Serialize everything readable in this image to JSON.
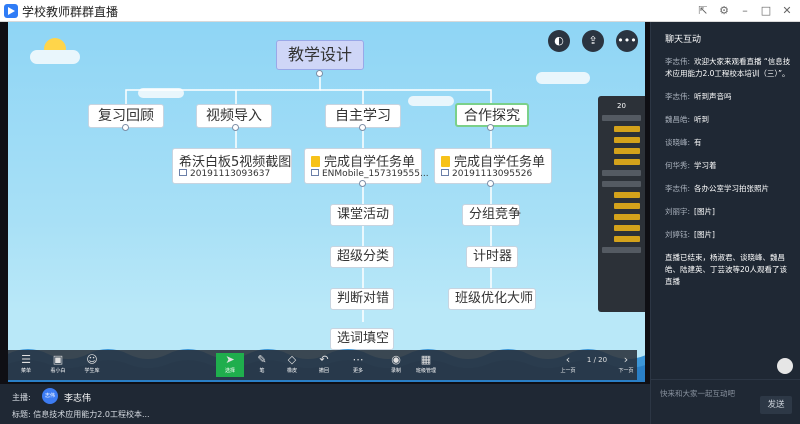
{
  "window": {
    "title": "学校教师群群直播"
  },
  "mindmap": {
    "root": "教学设计",
    "branches": [
      "复习回顾",
      "视频导入",
      "自主学习",
      "合作探究"
    ],
    "cards": [
      {
        "title": "希沃白板5视频截图",
        "file": "20191113093637"
      },
      {
        "title": "完成自学任务单",
        "file": "ENMobile_157319555..."
      },
      {
        "title": "完成自学任务单",
        "file": "20191113095526"
      }
    ],
    "left_leaves": [
      "课堂活动",
      "超级分类",
      "判断对错",
      "选词填空"
    ],
    "right_leaves": [
      "分组竞争",
      "计时器",
      "班级优化大师"
    ]
  },
  "mini_panel": {
    "count": "20"
  },
  "toolbar": {
    "items": [
      "菜单",
      "看小白",
      "学生库",
      "选择",
      "笔",
      "橡皮",
      "撤回",
      "更多",
      "录制",
      "班级管理",
      "上一页",
      "1 / 20",
      "下一页"
    ]
  },
  "info": {
    "host_label": "主播:",
    "host_avatar": "志伟",
    "host_name": "李志伟",
    "subject": "标题: 信息技术应用能力2.0工程校本..."
  },
  "chat": {
    "title": "聊天互动",
    "messages": [
      {
        "user": "李志伟:",
        "text": "欢迎大家来观看直播 “信息技术应用能力2.0工程校本培训（三）”。"
      },
      {
        "user": "李志伟:",
        "text": "听到声音吗"
      },
      {
        "user": "魏昌皓:",
        "text": "听到"
      },
      {
        "user": "谈晓峰:",
        "text": "有"
      },
      {
        "user": "何华秀:",
        "text": "学习着"
      },
      {
        "user": "李志伟:",
        "text": "各办公室学习拍张照片"
      },
      {
        "user": "刘丽宇:",
        "text": "[图片]"
      },
      {
        "user": "刘婷钰:",
        "text": "[图片]"
      }
    ],
    "system": "直播已结束，杨淑君、谈晓峰、魏昌皓、陆建英、丁芸波等20人观看了该直播",
    "placeholder": "快来和大家一起互动吧",
    "send": "发送"
  }
}
